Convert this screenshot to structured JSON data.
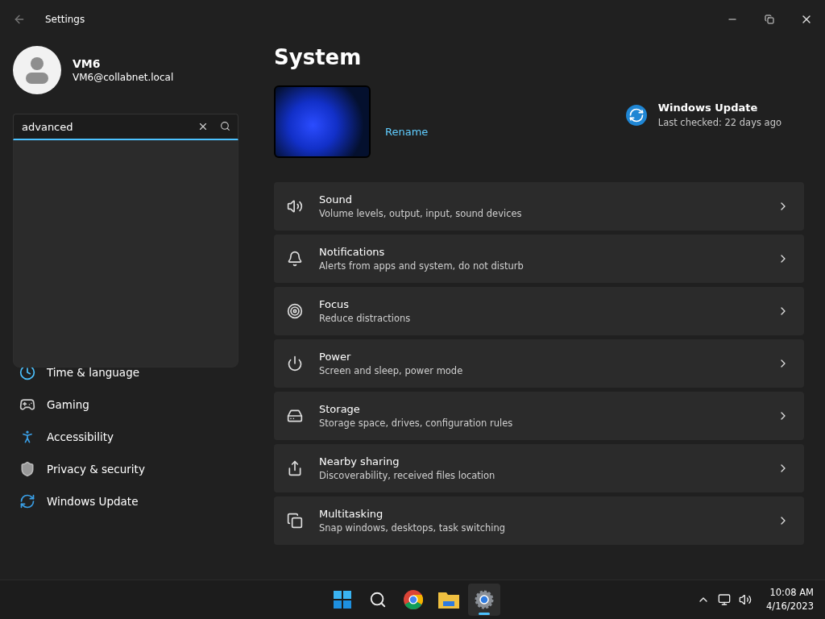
{
  "window": {
    "title": "Settings"
  },
  "account": {
    "name": "VM6",
    "email": "VM6@collabnet.local"
  },
  "search": {
    "value": "advanced"
  },
  "sidebar": {
    "items": [
      {
        "label": "Time & language",
        "selected": false
      },
      {
        "label": "Gaming",
        "selected": false
      },
      {
        "label": "Accessibility",
        "selected": false
      },
      {
        "label": "Privacy & security",
        "selected": false
      },
      {
        "label": "Windows Update",
        "selected": false
      }
    ]
  },
  "page": {
    "title": "System",
    "rename": "Rename",
    "update": {
      "title": "Windows Update",
      "status": "Last checked: 22 days ago"
    }
  },
  "settings": [
    {
      "title": "Sound",
      "description": "Volume levels, output, input, sound devices"
    },
    {
      "title": "Notifications",
      "description": "Alerts from apps and system, do not disturb"
    },
    {
      "title": "Focus",
      "description": "Reduce distractions"
    },
    {
      "title": "Power",
      "description": "Screen and sleep, power mode"
    },
    {
      "title": "Storage",
      "description": "Storage space, drives, configuration rules"
    },
    {
      "title": "Nearby sharing",
      "description": "Discoverability, received files location"
    },
    {
      "title": "Multitasking",
      "description": "Snap windows, desktops, task switching"
    }
  ],
  "taskbar": {
    "apps": [
      {
        "selected": false
      },
      {
        "selected": false
      },
      {
        "selected": false
      },
      {
        "selected": false
      },
      {
        "selected": true
      }
    ],
    "time": "10:08 AM",
    "date": "4/16/2023"
  }
}
